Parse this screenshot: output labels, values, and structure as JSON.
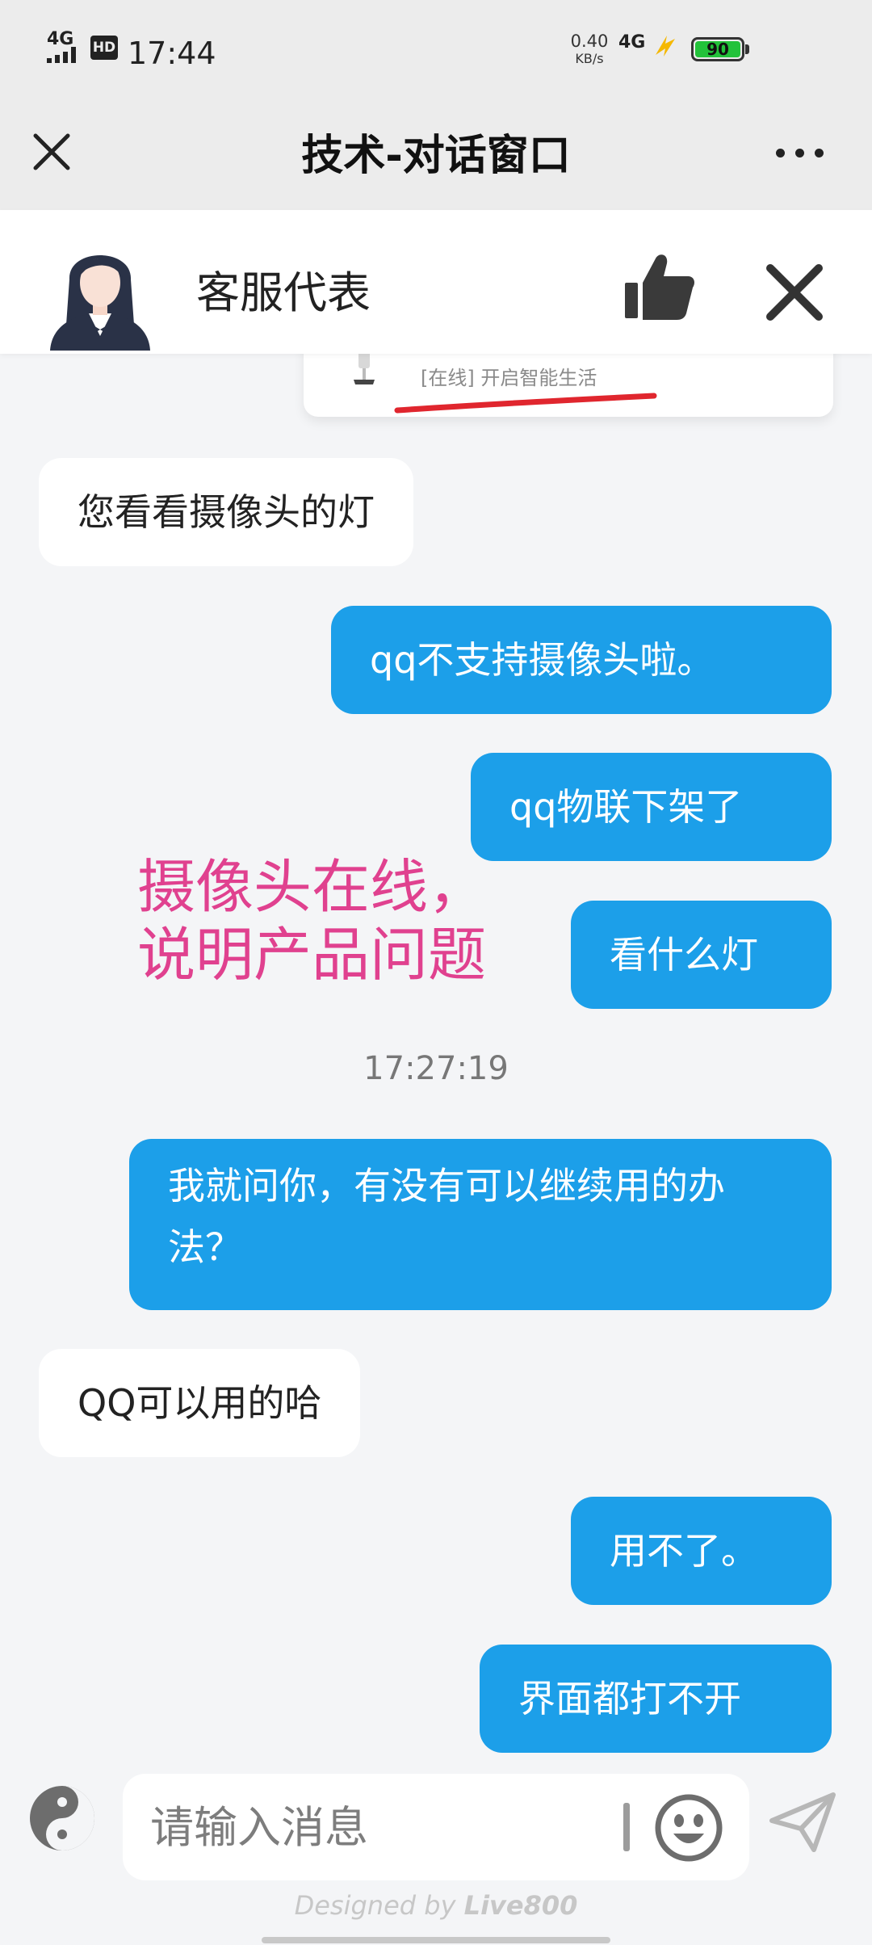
{
  "status_bar": {
    "network": "4G",
    "hd": "HD",
    "time": "17:44",
    "speed_value": "0.40",
    "speed_unit": "KB/s",
    "network_right": "4G",
    "battery": "90"
  },
  "title_bar": {
    "title": "技术-对话窗口",
    "close_icon": "close-icon",
    "more_icon": "more-dots-icon"
  },
  "agent": {
    "name": "客服代表",
    "avatar_icon": "agent-avatar",
    "like_icon": "thumbs-up-icon",
    "close_icon": "close-icon"
  },
  "card": {
    "status_text": "[在线] 开启智能生活"
  },
  "messages": [
    {
      "side": "in",
      "text": "您看看摄像头的灯"
    },
    {
      "side": "out",
      "text": "qq不支持摄像头啦。"
    },
    {
      "side": "out",
      "text": "qq物联下架了"
    },
    {
      "side": "out",
      "text": "看什么灯"
    },
    {
      "side": "out",
      "text": "我就问你，有没有可以继续用的办法？"
    },
    {
      "side": "in",
      "text": "QQ可以用的哈"
    },
    {
      "side": "out",
      "text": "用不了。"
    },
    {
      "side": "out",
      "text": "界面都打不开"
    }
  ],
  "timestamp": "17:27:19",
  "annotation": {
    "line1": "摄像头在线，",
    "line2": "说明产品问题",
    "color": "#e0418f"
  },
  "input": {
    "placeholder": "请输入消息",
    "value": ""
  },
  "footer": {
    "prefix": "Designed by",
    "brand": "Live800"
  },
  "colors": {
    "outgoing_bubble": "#1c9fe9",
    "incoming_bubble": "#ffffff",
    "background": "#f4f5f7"
  }
}
